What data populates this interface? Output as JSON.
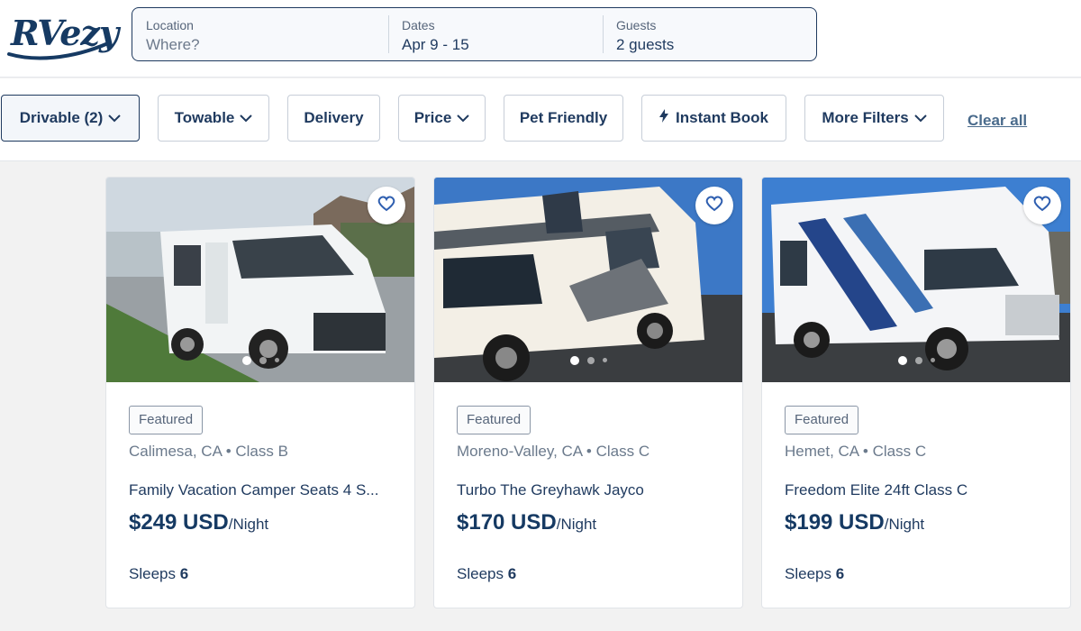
{
  "brand": {
    "name": "RVezy",
    "color": "#163a63"
  },
  "search": {
    "location": {
      "label": "Location",
      "placeholder": "Where?"
    },
    "dates": {
      "label": "Dates",
      "value": "Apr 9 - 15"
    },
    "guests": {
      "label": "Guests",
      "value": "2 guests"
    }
  },
  "filters": {
    "drivable": "Drivable (2)",
    "towable": "Towable",
    "delivery": "Delivery",
    "price": "Price",
    "pet_friendly": "Pet Friendly",
    "instant_book": "Instant Book",
    "more_filters": "More Filters",
    "clear_all": "Clear all"
  },
  "listings": [
    {
      "badge": "Featured",
      "location": "Calimesa, CA • Class B",
      "title": "Family Vacation Camper Seats 4 S...",
      "price": "$249 USD",
      "unit": "/Night",
      "sleeps_label": "Sleeps",
      "sleeps": "6"
    },
    {
      "badge": "Featured",
      "location": "Moreno-Valley, CA • Class C",
      "title": "Turbo The Greyhawk Jayco",
      "price": "$170 USD",
      "unit": "/Night",
      "sleeps_label": "Sleeps",
      "sleeps": "6"
    },
    {
      "badge": "Featured",
      "location": "Hemet, CA • Class C",
      "title": "Freedom Elite 24ft Class C",
      "price": "$199 USD",
      "unit": "/Night",
      "sleeps_label": "Sleeps",
      "sleeps": "6"
    }
  ],
  "icons": {
    "favorite": "heart-icon",
    "dropdown": "chevron-down-icon",
    "instant": "lightning-bolt-icon"
  },
  "colors": {
    "navy": "#1f3a5f",
    "link": "#4a6b8c",
    "muted": "#6b7a8c"
  }
}
